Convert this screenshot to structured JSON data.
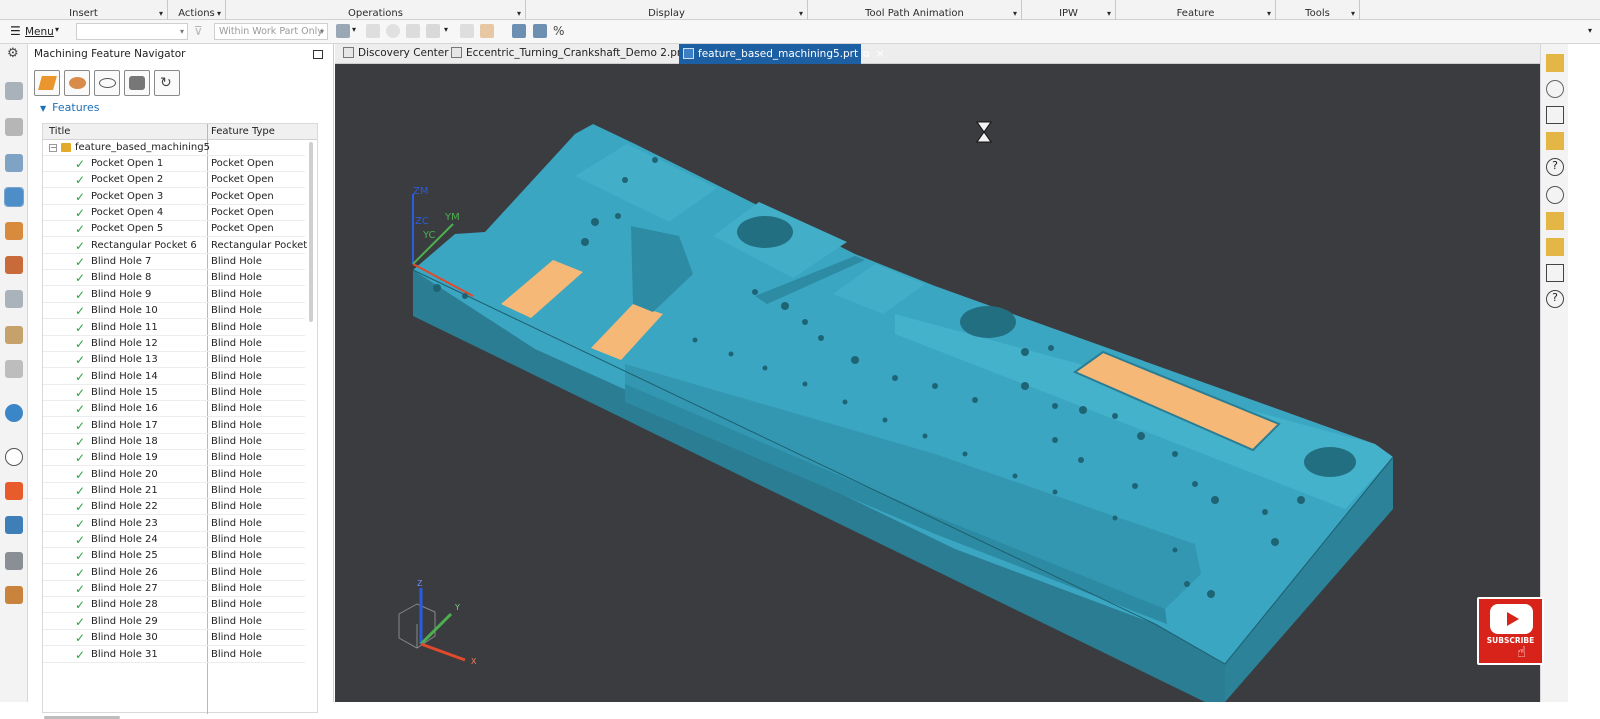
{
  "ribbon": {
    "groups": [
      {
        "label": "Insert",
        "has_dropdown": true
      },
      {
        "label": "Actions",
        "has_dropdown": true
      },
      {
        "label": "Operations",
        "has_dropdown": true
      },
      {
        "label": "Display",
        "has_dropdown": true
      },
      {
        "label": "Tool Path Animation",
        "has_dropdown": true
      },
      {
        "label": "IPW",
        "has_dropdown": true
      },
      {
        "label": "Feature",
        "has_dropdown": true
      },
      {
        "label": "Tools",
        "has_dropdown": true
      }
    ]
  },
  "commandbar": {
    "menu_label": "Menu",
    "filter_value": "",
    "scope_value": "Within Work Part Only"
  },
  "navigator": {
    "title": "Machining Feature Navigator",
    "section_label": "Features",
    "columns": [
      "Title",
      "Feature Type"
    ],
    "root": "feature_based_machining5",
    "rows": [
      {
        "title": "Pocket Open 1",
        "type": "Pocket Open"
      },
      {
        "title": "Pocket Open 2",
        "type": "Pocket Open"
      },
      {
        "title": "Pocket Open 3",
        "type": "Pocket Open"
      },
      {
        "title": "Pocket Open 4",
        "type": "Pocket Open"
      },
      {
        "title": "Pocket Open 5",
        "type": "Pocket Open"
      },
      {
        "title": "Rectangular Pocket 6",
        "type": "Rectangular Pocket"
      },
      {
        "title": "Blind Hole 7",
        "type": "Blind Hole"
      },
      {
        "title": "Blind Hole 8",
        "type": "Blind Hole"
      },
      {
        "title": "Blind Hole 9",
        "type": "Blind Hole"
      },
      {
        "title": "Blind Hole 10",
        "type": "Blind Hole"
      },
      {
        "title": "Blind Hole 11",
        "type": "Blind Hole"
      },
      {
        "title": "Blind Hole 12",
        "type": "Blind Hole"
      },
      {
        "title": "Blind Hole 13",
        "type": "Blind Hole"
      },
      {
        "title": "Blind Hole 14",
        "type": "Blind Hole"
      },
      {
        "title": "Blind Hole 15",
        "type": "Blind Hole"
      },
      {
        "title": "Blind Hole 16",
        "type": "Blind Hole"
      },
      {
        "title": "Blind Hole 17",
        "type": "Blind Hole"
      },
      {
        "title": "Blind Hole 18",
        "type": "Blind Hole"
      },
      {
        "title": "Blind Hole 19",
        "type": "Blind Hole"
      },
      {
        "title": "Blind Hole 20",
        "type": "Blind Hole"
      },
      {
        "title": "Blind Hole 21",
        "type": "Blind Hole"
      },
      {
        "title": "Blind Hole 22",
        "type": "Blind Hole"
      },
      {
        "title": "Blind Hole 23",
        "type": "Blind Hole"
      },
      {
        "title": "Blind Hole 24",
        "type": "Blind Hole"
      },
      {
        "title": "Blind Hole 25",
        "type": "Blind Hole"
      },
      {
        "title": "Blind Hole 26",
        "type": "Blind Hole"
      },
      {
        "title": "Blind Hole 27",
        "type": "Blind Hole"
      },
      {
        "title": "Blind Hole 28",
        "type": "Blind Hole"
      },
      {
        "title": "Blind Hole 29",
        "type": "Blind Hole"
      },
      {
        "title": "Blind Hole 30",
        "type": "Blind Hole"
      },
      {
        "title": "Blind Hole 31",
        "type": "Blind Hole"
      }
    ]
  },
  "tabs": [
    {
      "label": "Discovery Center",
      "active": false
    },
    {
      "label": "Eccentric_Turning_Crankshaft_Demo 2.prt",
      "active": false
    },
    {
      "label": "feature_based_machining5.prt",
      "active": true
    }
  ],
  "viewport": {
    "csys_labels": {
      "zm": "ZM",
      "zc": "ZC",
      "ym": "YM",
      "yc": "YC"
    },
    "triad_labels": {
      "z": "Z",
      "y": "Y",
      "x": "X"
    },
    "busy_icon": "hourglass-icon"
  },
  "overlay": {
    "subscribe_label": "SUBSCRIBE"
  },
  "colors": {
    "part": "#3aa6c2",
    "part_dark": "#2a7d93",
    "pocket_floor": "#f5b877",
    "background": "#3a3c40",
    "active_tab": "#1d5fa3",
    "check": "#2ea043",
    "subscribe_bg": "#d8231b"
  }
}
